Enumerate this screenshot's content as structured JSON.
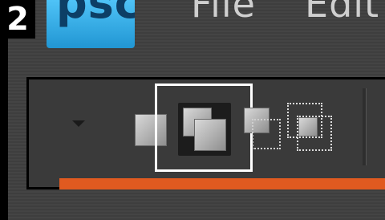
{
  "step": {
    "number": "2"
  },
  "header": {
    "app_logo_text": "psc",
    "menu": [
      {
        "label": "File"
      },
      {
        "label": "Edit"
      }
    ]
  },
  "options_bar": {
    "tools": [
      {
        "name": "new-selection",
        "state": "normal"
      },
      {
        "name": "add-to-selection",
        "state": "active"
      },
      {
        "name": "subtract-from-selection",
        "state": "normal"
      },
      {
        "name": "intersect-with-selection",
        "state": "normal"
      }
    ],
    "dropdown_icon": "chevron-down-icon"
  },
  "colors": {
    "accent": "#e05a20",
    "logo_blue": "#2196d3",
    "highlight": "#ffffff"
  }
}
